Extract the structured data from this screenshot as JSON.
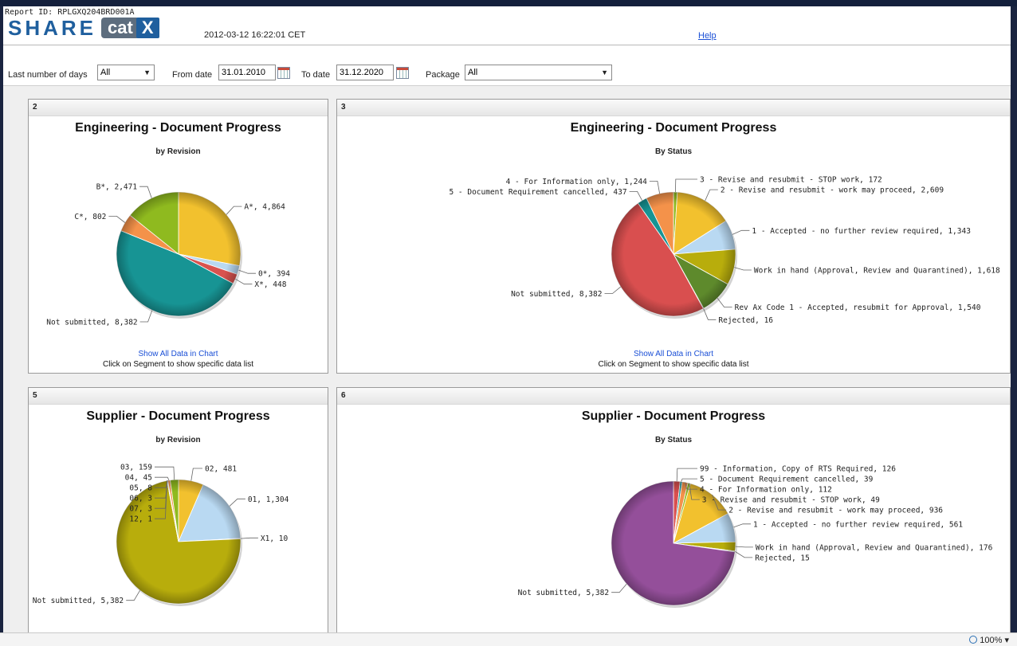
{
  "header": {
    "report_id": "Report ID: RPLGXQ204BRD001A",
    "logo_share": "SHARE",
    "logo_cat": "cat",
    "logo_x": "X",
    "timestamp": "2012-03-12 16:22:01 CET",
    "help": "Help"
  },
  "filters": {
    "days_label": "Last number of days",
    "days_value": "All",
    "from_label": "From date",
    "from_value": "31.01.2010",
    "to_label": "To date",
    "to_value": "31.12.2020",
    "package_label": "Package",
    "package_value": "All"
  },
  "common": {
    "show_all": "Show All Data in Chart",
    "click_hint": "Click on Segment to show specific data list"
  },
  "panels": [
    {
      "number": "2",
      "title": "Engineering - Document Progress",
      "subtitle": "by Revision"
    },
    {
      "number": "3",
      "title": "Engineering - Document Progress",
      "subtitle": "By Status"
    },
    {
      "number": "5",
      "title": "Supplier - Document Progress",
      "subtitle": "by Revision"
    },
    {
      "number": "6",
      "title": "Supplier - Document Progress",
      "subtitle": "By Status"
    }
  ],
  "status": {
    "zoom": "100%"
  },
  "chart_data": [
    {
      "type": "pie",
      "title": "Engineering - Document Progress",
      "subtitle": "by Revision",
      "slices": [
        {
          "label": "A*",
          "value": 4864,
          "color": "#f2c12e"
        },
        {
          "label": "0*",
          "value": 394,
          "color": "#b9d9f2"
        },
        {
          "label": "X*",
          "value": 448,
          "color": "#d9534f"
        },
        {
          "label": "Not submitted",
          "value": 8382,
          "color": "#179494"
        },
        {
          "label": "C*",
          "value": 802,
          "color": "#f4924a"
        },
        {
          "label": "B*",
          "value": 2471,
          "color": "#8fba1f"
        }
      ]
    },
    {
      "type": "pie",
      "title": "Engineering - Document Progress",
      "subtitle": "By Status",
      "slices": [
        {
          "label": "3 - Revise and resubmit - STOP work",
          "value": 172,
          "color": "#8fba1f"
        },
        {
          "label": "2 - Revise and resubmit - work may proceed",
          "value": 2609,
          "color": "#f2c12e"
        },
        {
          "label": "1 - Accepted - no further review required",
          "value": 1343,
          "color": "#b9d9f2"
        },
        {
          "label": "Work in hand (Approval, Review and Quarantined)",
          "value": 1618,
          "color": "#b8ad0c"
        },
        {
          "label": "Rev Ax Code 1 - Accepted, resubmit for Approval",
          "value": 1540,
          "color": "#5e8a2c"
        },
        {
          "label": "Rejected",
          "value": 16,
          "color": "#4a3a90"
        },
        {
          "label": "Not submitted",
          "value": 8382,
          "color": "#d94f4f"
        },
        {
          "label": "5 - Document Requirement cancelled",
          "value": 437,
          "color": "#179494"
        },
        {
          "label": "4 - For Information only",
          "value": 1244,
          "color": "#f4924a"
        }
      ]
    },
    {
      "type": "pie",
      "title": "Supplier - Document Progress",
      "subtitle": "by Revision",
      "slices": [
        {
          "label": "02",
          "value": 481,
          "color": "#f2c12e"
        },
        {
          "label": "01",
          "value": 1304,
          "color": "#b9d9f2"
        },
        {
          "label": "X1",
          "value": 10,
          "color": "#d9534f"
        },
        {
          "label": "Not submitted",
          "value": 5382,
          "color": "#b8ad0c"
        },
        {
          "label": "12",
          "value": 1,
          "color": "#4a3a90"
        },
        {
          "label": "07",
          "value": 3,
          "color": "#5e8a2c"
        },
        {
          "label": "06",
          "value": 3,
          "color": "#d94f4f"
        },
        {
          "label": "05",
          "value": 8,
          "color": "#179494"
        },
        {
          "label": "04",
          "value": 45,
          "color": "#f4924a"
        },
        {
          "label": "03",
          "value": 159,
          "color": "#8fba1f"
        }
      ]
    },
    {
      "type": "pie",
      "title": "Supplier - Document Progress",
      "subtitle": "By Status",
      "slices": [
        {
          "label": "99 - Information, Copy of RTS Required",
          "value": 126,
          "color": "#d94f4f"
        },
        {
          "label": "5 - Document Requirement cancelled",
          "value": 39,
          "color": "#179494"
        },
        {
          "label": "4 - For Information only",
          "value": 112,
          "color": "#f4924a"
        },
        {
          "label": "3 - Revise and resubmit - STOP work",
          "value": 49,
          "color": "#8fba1f"
        },
        {
          "label": "2 - Revise and resubmit - work may proceed",
          "value": 936,
          "color": "#f2c12e"
        },
        {
          "label": "1 - Accepted - no further review required",
          "value": 561,
          "color": "#b9d9f2"
        },
        {
          "label": "Work in hand (Approval, Review and Quarantined)",
          "value": 176,
          "color": "#b8ad0c"
        },
        {
          "label": "Rejected",
          "value": 15,
          "color": "#5e8a2c"
        },
        {
          "label": "Not submitted",
          "value": 5382,
          "color": "#944f9a"
        }
      ]
    }
  ]
}
